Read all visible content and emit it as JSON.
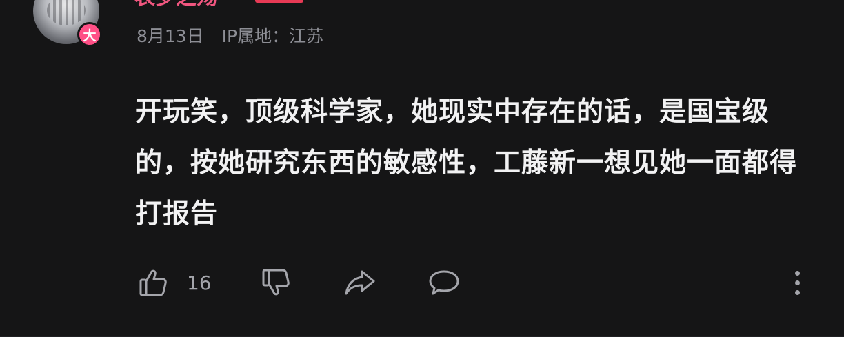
{
  "user": {
    "username": "表罗之殇",
    "avatar_badge": "大",
    "level_badge_color": "#e73a55"
  },
  "meta": {
    "date": "8月13日",
    "ip_location": "IP属地：江苏"
  },
  "comment": {
    "text": "开玩笑，顶级科学家，她现实中存在的话，是国宝级的，按她研究东西的敏感性，工藤新一想见她一面都得打报告"
  },
  "actions": {
    "like_count": "16",
    "like_icon": "thumbs-up-icon",
    "dislike_icon": "thumbs-down-icon",
    "share_icon": "share-icon",
    "reply_icon": "comment-icon",
    "more_icon": "more-vertical-icon"
  },
  "colors": {
    "background": "#151516",
    "username": "#f0567f",
    "meta_text": "#8d8e95",
    "comment_text": "#f2f2f3",
    "icon": "#a4a5ab"
  }
}
